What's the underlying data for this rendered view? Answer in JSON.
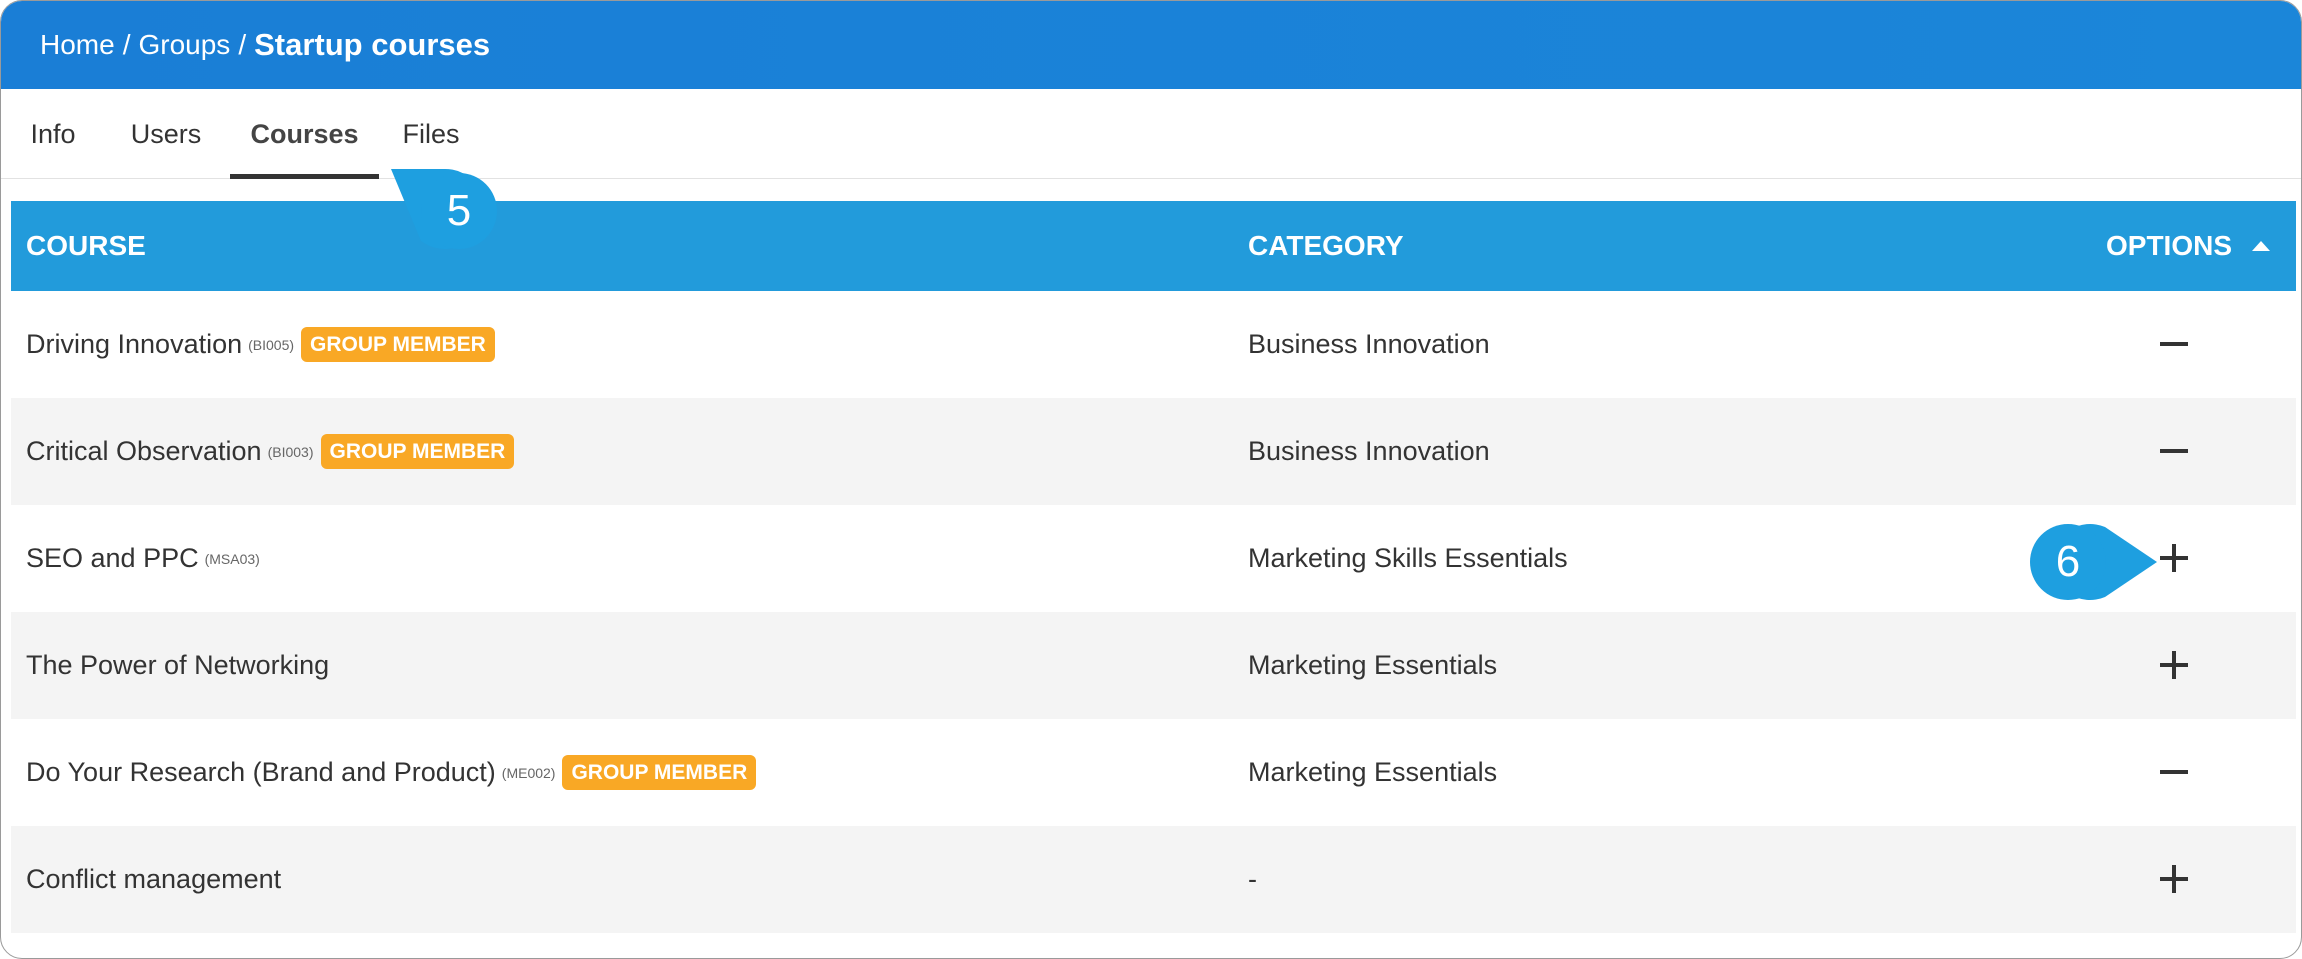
{
  "breadcrumb": {
    "home": "Home",
    "groups": "Groups",
    "separator": "/",
    "current": "Startup courses"
  },
  "tabs": [
    {
      "label": "Info",
      "active": false
    },
    {
      "label": "Users",
      "active": false
    },
    {
      "label": "Courses",
      "active": true
    },
    {
      "label": "Files",
      "active": false
    }
  ],
  "table": {
    "headers": {
      "course": "COURSE",
      "category": "CATEGORY",
      "options": "OPTIONS"
    },
    "sort": "ascending",
    "rows": [
      {
        "course": "Driving Innovation",
        "code": "(BI005)",
        "badge": "GROUP MEMBER",
        "category": "Business Innovation",
        "option": "remove"
      },
      {
        "course": "Critical Observation",
        "code": "(BI003)",
        "badge": "GROUP MEMBER",
        "category": "Business Innovation",
        "option": "remove"
      },
      {
        "course": "SEO and PPC",
        "code": "(MSA03)",
        "badge": "",
        "category": "Marketing Skills Essentials",
        "option": "add"
      },
      {
        "course": "The Power of Networking",
        "code": "",
        "badge": "",
        "category": "Marketing Essentials",
        "option": "add"
      },
      {
        "course": "Do Your Research (Brand and Product)",
        "code": "(ME002)",
        "badge": "GROUP MEMBER",
        "category": "Marketing Essentials",
        "option": "remove"
      },
      {
        "course": "Conflict management",
        "code": "",
        "badge": "",
        "category": "-",
        "option": "add"
      }
    ]
  },
  "callouts": {
    "tabs": "5",
    "options": "6"
  },
  "colors": {
    "header": "#1a7ed6",
    "table_header": "#229bdb",
    "badge": "#f9a825",
    "callout": "#1e9fe0"
  },
  "icons": {
    "remove": "minus-icon",
    "add": "plus-icon",
    "sort": "sort-ascending-icon"
  }
}
